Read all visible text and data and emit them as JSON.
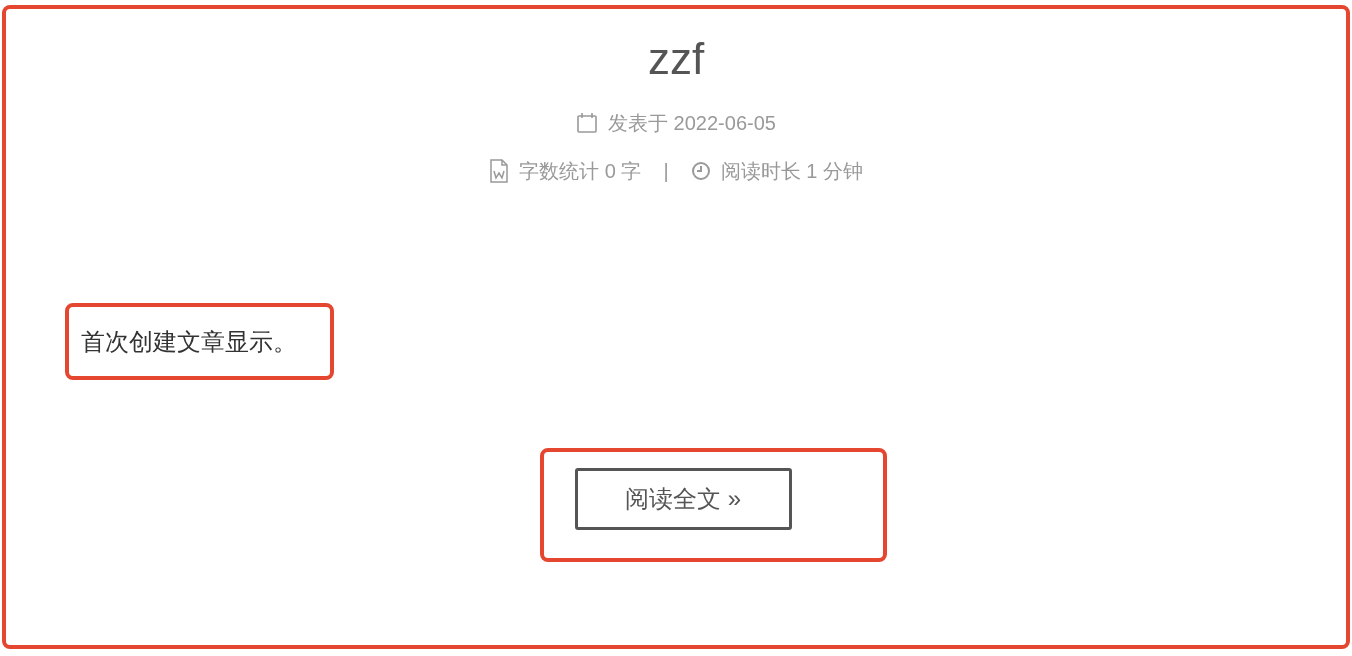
{
  "post": {
    "title": "zzf",
    "published": "发表于 2022-06-05",
    "word_count": "字数统计 0 字",
    "separator": "|",
    "read_time": "阅读时长 1 分钟",
    "excerpt": "首次创建文章显示。",
    "read_more": "阅读全文 »"
  }
}
